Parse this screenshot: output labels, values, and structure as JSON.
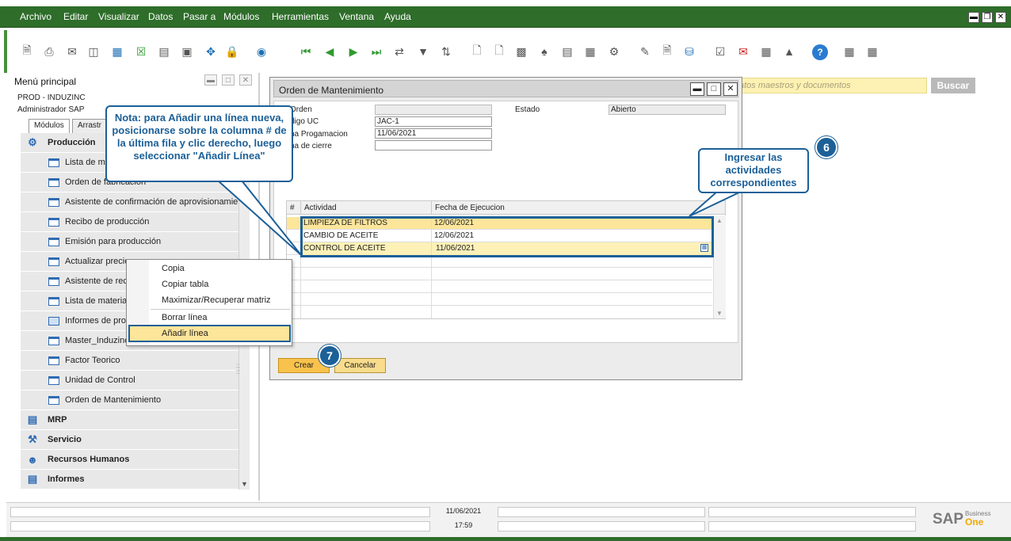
{
  "menu": [
    "Archivo",
    "Editar",
    "Visualizar",
    "Datos",
    "Pasar a",
    "Módulos",
    "Herramientas",
    "Ventana",
    "Ayuda"
  ],
  "search": {
    "placeholder": "atos maestros y documentos",
    "button": "Buscar"
  },
  "sidebar": {
    "title": "Menú principal",
    "company": "PROD - INDUZINC",
    "user": "Administrador SAP",
    "tabs": [
      "Módulos",
      "Arrastr"
    ],
    "group_top": "Producción",
    "items": [
      "Lista de ma",
      "Orden de fabricación",
      "Asistente de confirmación de aprovisionamie",
      "Recibo de producción",
      "Emisión para producción",
      "Actualizar precios",
      "Asistente de reca",
      "Lista de materiales",
      "Informes de prod",
      "Master_Induzinc",
      "Factor Teorico",
      "Unidad de Control",
      "Orden de Mantenimiento"
    ],
    "groups": [
      "MRP",
      "Servicio",
      "Recursos Humanos",
      "Informes"
    ]
  },
  "order": {
    "title": "Orden de Mantenimiento",
    "labels": {
      "orden": "Orden",
      "codigo": "digo UC",
      "fecha_prog": "ha Progamacion",
      "fecha_cierre": "ha de cierre",
      "estado": "Estado"
    },
    "values": {
      "orden": "",
      "codigo": "JAC-1",
      "fecha_prog": "11/06/2021",
      "fecha_cierre": "",
      "estado": "Abierto"
    },
    "grid": {
      "headers": [
        "#",
        "Actividad",
        "Fecha de Ejecucion"
      ],
      "rows": [
        {
          "actividad": "LIMPIEZA DE FILTROS",
          "fecha": "12/06/2021"
        },
        {
          "actividad": "CAMBIO DE ACEITE",
          "fecha": "12/06/2021"
        },
        {
          "actividad": "CONTROL DE ACEITE",
          "fecha": "11/06/2021"
        }
      ]
    },
    "buttons": {
      "crear": "Crear",
      "cancelar": "Cancelar"
    }
  },
  "context_menu": [
    "Copia",
    "Copiar tabla",
    "Maximizar/Recuperar matriz",
    "Borrar línea",
    "Añadir línea"
  ],
  "callouts": {
    "note": "Nota: para Añadir una línea nueva, posicionarse sobre la columna # de la última fila y clic derecho, luego seleccionar \"Añadir Línea\"",
    "activities": "Ingresar las actividades correspondientes",
    "badge6": "6",
    "badge7": "7"
  },
  "status": {
    "date": "11/06/2021",
    "time": "17:59"
  },
  "brand": {
    "sap": "SAP",
    "business": "Business",
    "one": "One"
  },
  "colors": {
    "menubar": "#2e6d2a",
    "callout": "#1c6098",
    "highlight": "#fde59a",
    "button": "#f9c24c"
  }
}
